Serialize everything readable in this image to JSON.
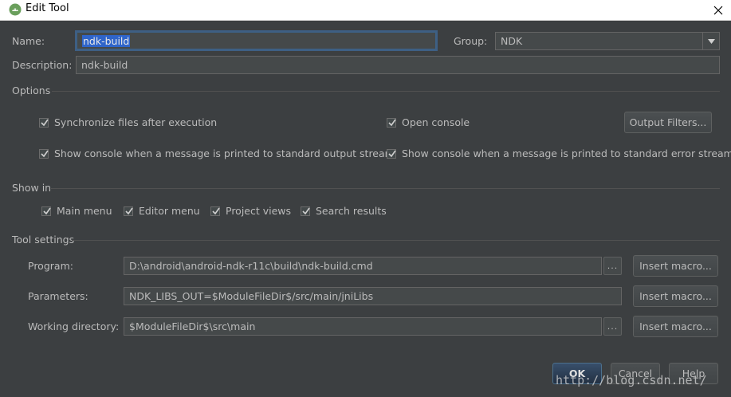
{
  "window": {
    "title": "Edit Tool"
  },
  "icons": {
    "app": "android-icon",
    "close": "close-icon",
    "dropdown": "chevron-down-icon",
    "checkbox": "checkmark-icon"
  },
  "form": {
    "name_label": "Name:",
    "name_value": "ndk-build",
    "group_label": "Group:",
    "group_value": "NDK",
    "description_label": "Description:",
    "description_value": "ndk-build"
  },
  "options": {
    "title": "Options",
    "sync_files": "Synchronize files after execution",
    "open_console": "Open console",
    "output_filters": "Output Filters...",
    "show_console_stdout": "Show console when a message is printed to standard output stream",
    "show_console_stderr": "Show console when a message is printed to standard error stream"
  },
  "show_in": {
    "title": "Show in",
    "items": [
      "Main menu",
      "Editor menu",
      "Project views",
      "Search results"
    ]
  },
  "tool_settings": {
    "title": "Tool settings",
    "program_label": "Program:",
    "program_value": "D:\\android\\android-ndk-r11c\\build\\ndk-build.cmd",
    "parameters_label": "Parameters:",
    "parameters_value": "NDK_LIBS_OUT=$ModuleFileDir$/src/main/jniLibs",
    "workdir_label": "Working directory:",
    "workdir_value": "$ModuleFileDir$\\src\\main",
    "browse_label": "...",
    "insert_macro": "Insert macro..."
  },
  "footer": {
    "ok": "OK",
    "cancel": "Cancel",
    "help": "Help"
  },
  "watermark": "http://blog.csdn.net/"
}
